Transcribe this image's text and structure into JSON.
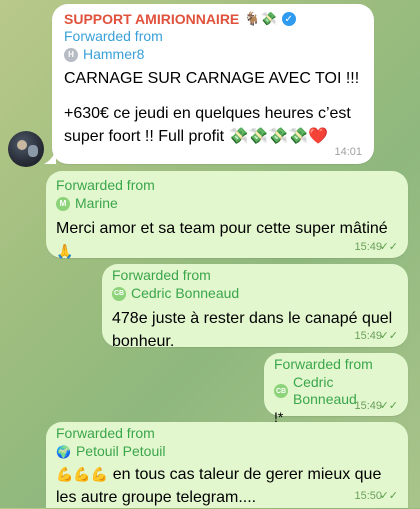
{
  "messages": [
    {
      "channel": "SUPPORT AMIRIONNAIRE",
      "channel_emojis": "🐐💸",
      "forwarded_label": "Forwarded from",
      "from_initial": "H",
      "from_name": "Hammer8",
      "line1": "CARNAGE SUR CARNAGE AVEC TOI !!!",
      "line2": "+630€ ce jeudi en quelques heures c’est",
      "line3": "super foort !! Full profit 💸💸💸💸❤️",
      "time": "14:01"
    },
    {
      "forwarded_label": "Forwarded from",
      "from_initial": "M",
      "from_name": "Marine",
      "line1": "Merci amor et sa team pour cette super mâtiné",
      "line2": "🙏",
      "time": "15:49"
    },
    {
      "forwarded_label": "Forwarded from",
      "from_initial": "CB",
      "from_name": "Cedric Bonneaud",
      "line1": "478e juste à rester dans le canapé quel",
      "line2": "bonheur.",
      "time": "15:49"
    },
    {
      "forwarded_label": "Forwarded from",
      "from_initial": "CB",
      "from_name": "Cedric Bonneaud",
      "line1": "!*",
      "time": "15:49"
    },
    {
      "forwarded_label": "Forwarded from",
      "from_emoji": "🌍",
      "from_name": "Petouil Petouil",
      "line1_emojis": "💪💪💪",
      "line1": "en tous cas taleur de gerer mieux que",
      "line2": "les autre groupe telegram....",
      "time": "15:50"
    }
  ],
  "colors": {
    "forward_green": "#3aa64a",
    "outgoing_bubble": "#e3f7cf",
    "incoming_bubble": "#ffffff",
    "channel_red": "#e0523c",
    "verified_blue": "#2f9bf0"
  },
  "icons": {
    "verified": "verified-badge-icon",
    "read_receipt": "double-check-icon"
  }
}
